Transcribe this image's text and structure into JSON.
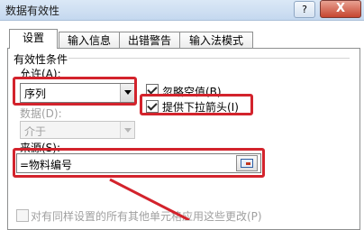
{
  "dialog": {
    "title": "数据有效性",
    "help_glyph": "?",
    "close_glyph": "X"
  },
  "tabs": [
    {
      "label": "设置",
      "active": true
    },
    {
      "label": "输入信息",
      "active": false
    },
    {
      "label": "出错警告",
      "active": false
    },
    {
      "label": "输入法模式",
      "active": false
    }
  ],
  "settings": {
    "group_label": "有效性条件",
    "allow_label": "允许(A):",
    "allow_value": "序列",
    "data_label": "数据(D):",
    "data_value": "介于",
    "ignore_blank_label": "忽略空值(B)",
    "ignore_blank_checked": true,
    "dropdown_label": "提供下拉箭头(I)",
    "dropdown_checked": true,
    "source_label": "来源(S):",
    "source_value": "=物料编号",
    "apply_all_label": "对有同样设置的所有其他单元格应用这些更改(P)",
    "apply_all_checked": false
  },
  "colors": {
    "highlight": "#d3232c",
    "titlebar": "#c4d8ef",
    "close_button": "#c64530"
  },
  "icons": [
    "question-icon",
    "close-icon",
    "dropdown-arrow-icon",
    "range-picker-icon"
  ]
}
